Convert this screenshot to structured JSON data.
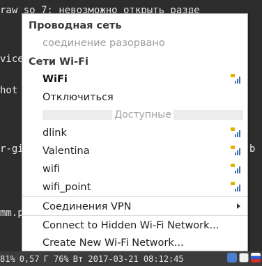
{
  "terminal": {
    "lines": [
      "raw so 7: невозможно открыть разде",
      "vice",
      "hot",
      "r-gi",
      "mm.p"
    ],
    "right_fragment": "b"
  },
  "menu": {
    "wired_header": "Проводная сеть",
    "wired_status": "соединение разорвано",
    "wifi_header": "Сети Wi-Fi",
    "current_network": "WiFi",
    "disconnect": "Отключиться",
    "available_title": "Доступные",
    "networks": [
      {
        "name": "dlink",
        "icon": "wifi-signal-locked-icon"
      },
      {
        "name": "Valentina",
        "icon": "wifi-signal-locked-icon"
      },
      {
        "name": "wifi",
        "icon": "wifi-signal-locked-icon"
      },
      {
        "name": "wifi_point",
        "icon": "wifi-signal-locked-icon"
      }
    ],
    "vpn": "Соединения VPN",
    "connect_hidden": "Connect to Hidden Wi-Fi Network...",
    "create_new": "Create New Wi-Fi Network..."
  },
  "statusbar": {
    "battery": "81%",
    "load": "0,57",
    "mem": "Г 76%",
    "datetime": "Вт 2017-03-21 08:12:45"
  },
  "colors": {
    "signal": "#3f6fb0",
    "lock": "#e0b300",
    "terminal_bg": "#2d2d2d",
    "statusbar_bg": "#3c3c3c"
  }
}
